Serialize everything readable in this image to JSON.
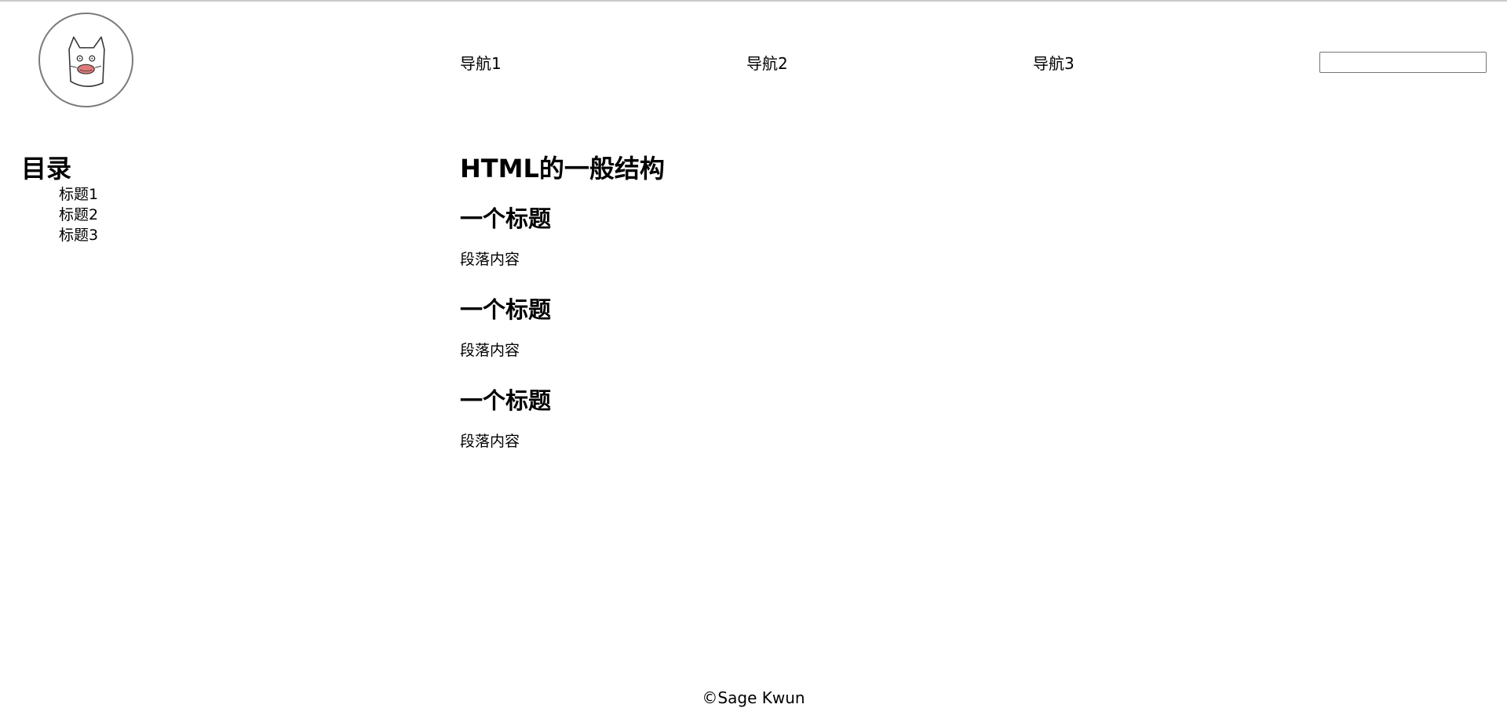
{
  "header": {
    "logo_icon": "cat-mascot-icon",
    "nav": [
      {
        "label": "导航1"
      },
      {
        "label": "导航2"
      },
      {
        "label": "导航3"
      }
    ],
    "search": {
      "value": "",
      "placeholder": ""
    }
  },
  "sidebar": {
    "title": "目录",
    "items": [
      {
        "label": "标题1"
      },
      {
        "label": "标题2"
      },
      {
        "label": "标题3"
      }
    ]
  },
  "main": {
    "title": "HTML的一般结构",
    "sections": [
      {
        "heading": "一个标题",
        "paragraph": "段落内容"
      },
      {
        "heading": "一个标题",
        "paragraph": "段落内容"
      },
      {
        "heading": "一个标题",
        "paragraph": "段落内容"
      }
    ]
  },
  "footer": {
    "text": "©Sage Kwun"
  },
  "colors": {
    "logo_border": "#7a7a7a",
    "cat_mouth": "#e07b7b"
  }
}
